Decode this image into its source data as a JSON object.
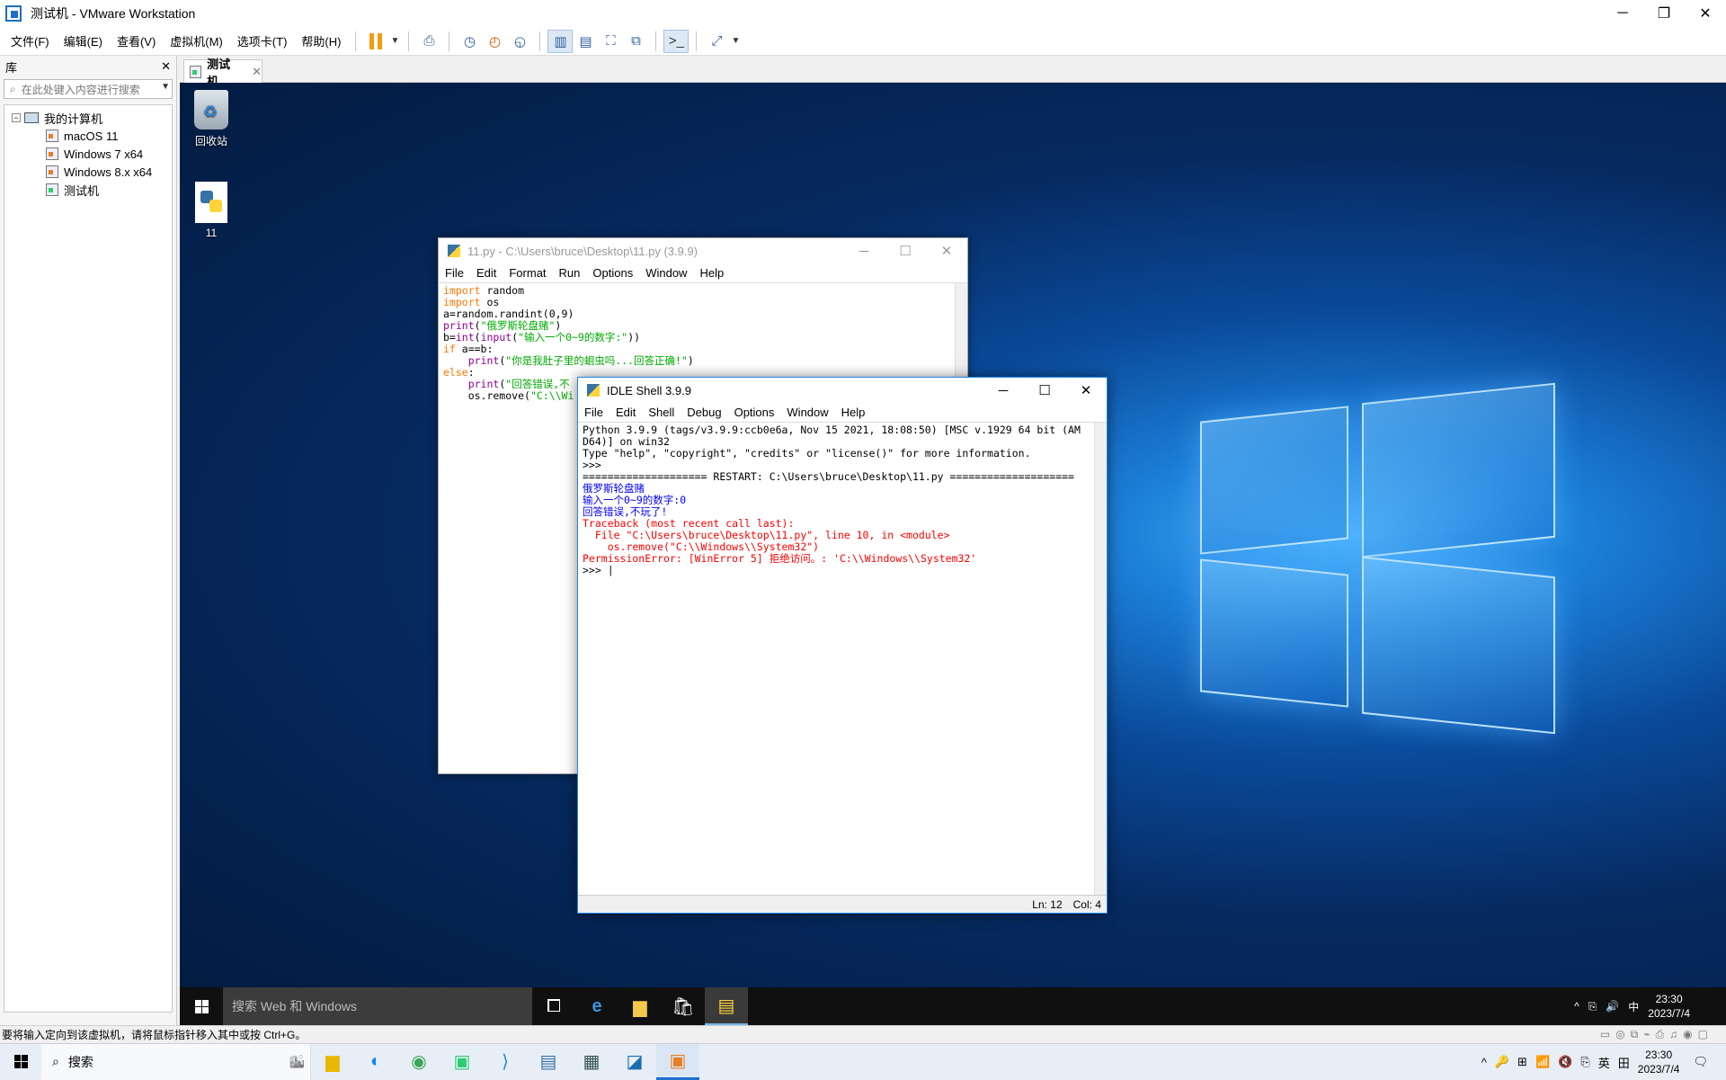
{
  "window": {
    "title": "测试机 - VMware Workstation"
  },
  "menu": [
    "文件(F)",
    "编辑(E)",
    "查看(V)",
    "虚拟机(M)",
    "选项卡(T)",
    "帮助(H)"
  ],
  "toolbar": {
    "icons": [
      "pause-icon",
      "dropdown-icon",
      "send-keys-icon",
      "snapshot-icon",
      "revert-snapshot-icon",
      "snapshot-manager-icon",
      "library-view-icon",
      "thumbnail-view-icon",
      "fullscreen-icon",
      "unity-icon",
      "console-icon",
      "stretch-icon"
    ]
  },
  "library": {
    "header": "库",
    "close": "✕",
    "search_placeholder": "在此处键入内容进行搜索",
    "tree": {
      "root": "我的计算机",
      "items": [
        "macOS 11",
        "Windows 7 x64",
        "Windows 8.x x64",
        "测试机"
      ]
    }
  },
  "tab": {
    "label": "测试机",
    "close": "✕"
  },
  "desktop": {
    "icons": [
      {
        "label": "回收站"
      },
      {
        "label": "11"
      }
    ]
  },
  "editor": {
    "title": "11.py - C:\\Users\\bruce\\Desktop\\11.py (3.9.9)",
    "menu": [
      "File",
      "Edit",
      "Format",
      "Run",
      "Options",
      "Window",
      "Help"
    ]
  },
  "shell": {
    "title": "IDLE Shell 3.9.9",
    "menu": [
      "File",
      "Edit",
      "Shell",
      "Debug",
      "Options",
      "Window",
      "Help"
    ],
    "lines": [
      {
        "text": "Python 3.9.9 (tags/v3.9.9:ccb0e6a, Nov 15 2021, 18:08:50) [MSC v.1929 64 bit (AM",
        "color": "#000000"
      },
      {
        "text": "D64)] on win32",
        "color": "#000000"
      },
      {
        "text": "Type \"help\", \"copyright\", \"credits\" or \"license()\" for more information.",
        "color": "#000000"
      },
      {
        "text": ">>>",
        "color": "#000000"
      },
      {
        "text": "==================== RESTART: C:\\Users\\bruce\\Desktop\\11.py ====================",
        "color": "#000000"
      },
      {
        "text": "俄罗斯轮盘赌",
        "color": "#0000ff"
      },
      {
        "text": "输入一个0~9的数字:0",
        "color": "#0000ff"
      },
      {
        "text": "回答错误,不玩了!",
        "color": "#0000ff"
      },
      {
        "text": "Traceback (most recent call last):",
        "color": "#ff0000"
      },
      {
        "text": "  File \"C:\\Users\\bruce\\Desktop\\11.py\", line 10, in <module>",
        "color": "#ff0000"
      },
      {
        "text": "    os.remove(\"C:\\\\Windows\\\\System32\")",
        "color": "#ff0000"
      },
      {
        "text": "PermissionError: [WinError 5] 拒绝访问。: 'C:\\\\Windows\\\\System32'",
        "color": "#ff0000"
      },
      {
        "text": ">>> |",
        "color": "#000000"
      }
    ],
    "status": {
      "ln": "Ln: 12",
      "col": "Col: 4"
    }
  },
  "guest_taskbar": {
    "search": "搜索 Web 和 Windows",
    "icons": [
      "task-view-icon",
      "edge-icon",
      "file-explorer-icon",
      "store-icon",
      "idle-icon"
    ],
    "tray": [
      "^",
      "⎘",
      "🔊",
      "中"
    ],
    "time": "23:30",
    "date": "2023/7/4"
  },
  "host_status": {
    "text": "要将输入定向到该虚拟机，请将鼠标指针移入其中或按 Ctrl+G。"
  },
  "host_taskbar": {
    "search": "搜索",
    "icons": [
      "city-widget-icon",
      "file-explorer-icon",
      "edge-icon",
      "edge-alt-icon",
      "green-app-icon",
      "vscode-icon",
      "python-file-icon",
      "remote-desktop-icon",
      "sublime-icon",
      "vmware-icon"
    ],
    "tray": [
      "^",
      "🔑",
      "⊞",
      "📶",
      "🔇",
      "⎘",
      "英",
      "田"
    ],
    "time": "23:30",
    "date": "2023/7/4"
  }
}
